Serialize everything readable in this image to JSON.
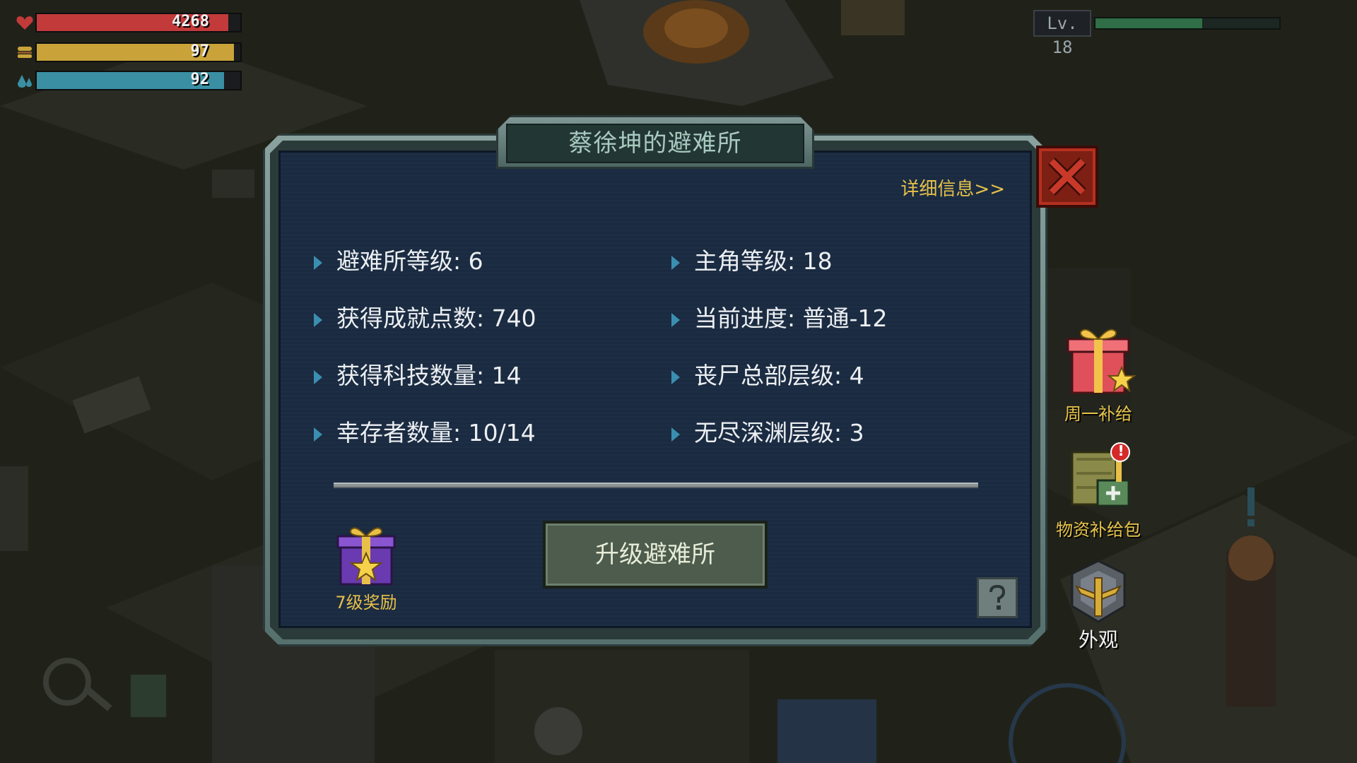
{
  "hud": {
    "health": {
      "value": "4268",
      "fill": 0.94,
      "color": "#c23a3a"
    },
    "hunger": {
      "value": "97",
      "fill": 0.97,
      "color": "#c9a33a"
    },
    "water": {
      "value": "92",
      "fill": 0.92,
      "color": "#3a8fa3"
    },
    "level": {
      "label": "Lv. 18",
      "progress": 0.58
    }
  },
  "dialog": {
    "title": "蔡徐坤的避难所",
    "detail_link": "详细信息>>",
    "stats_left": [
      {
        "label": "避难所等级: 6"
      },
      {
        "label": "获得成就点数: 740"
      },
      {
        "label": "获得科技数量: 14"
      },
      {
        "label": "幸存者数量: 10/14"
      }
    ],
    "stats_right": [
      {
        "label": "主角等级: 18"
      },
      {
        "label": "当前进度: 普通-12"
      },
      {
        "label": "丧尸总部层级: 4"
      },
      {
        "label": "无尽深渊层级: 3"
      }
    ],
    "reward_label": "7级奖励",
    "upgrade_button": "升级避难所",
    "help_icon": "question-icon",
    "close_icon": "close-icon"
  },
  "side_menu": [
    {
      "label": "周一补给",
      "icon": "gift-star-icon"
    },
    {
      "label": "物资补给包",
      "icon": "supply-crate-icon",
      "alert": "!"
    },
    {
      "label": "外观",
      "icon": "appearance-emblem-icon"
    }
  ],
  "colors": {
    "accent_gold": "#e6c24a",
    "panel_bg": "#1c2d44",
    "frame": "#6f8886",
    "close_red": "#a8291a"
  }
}
